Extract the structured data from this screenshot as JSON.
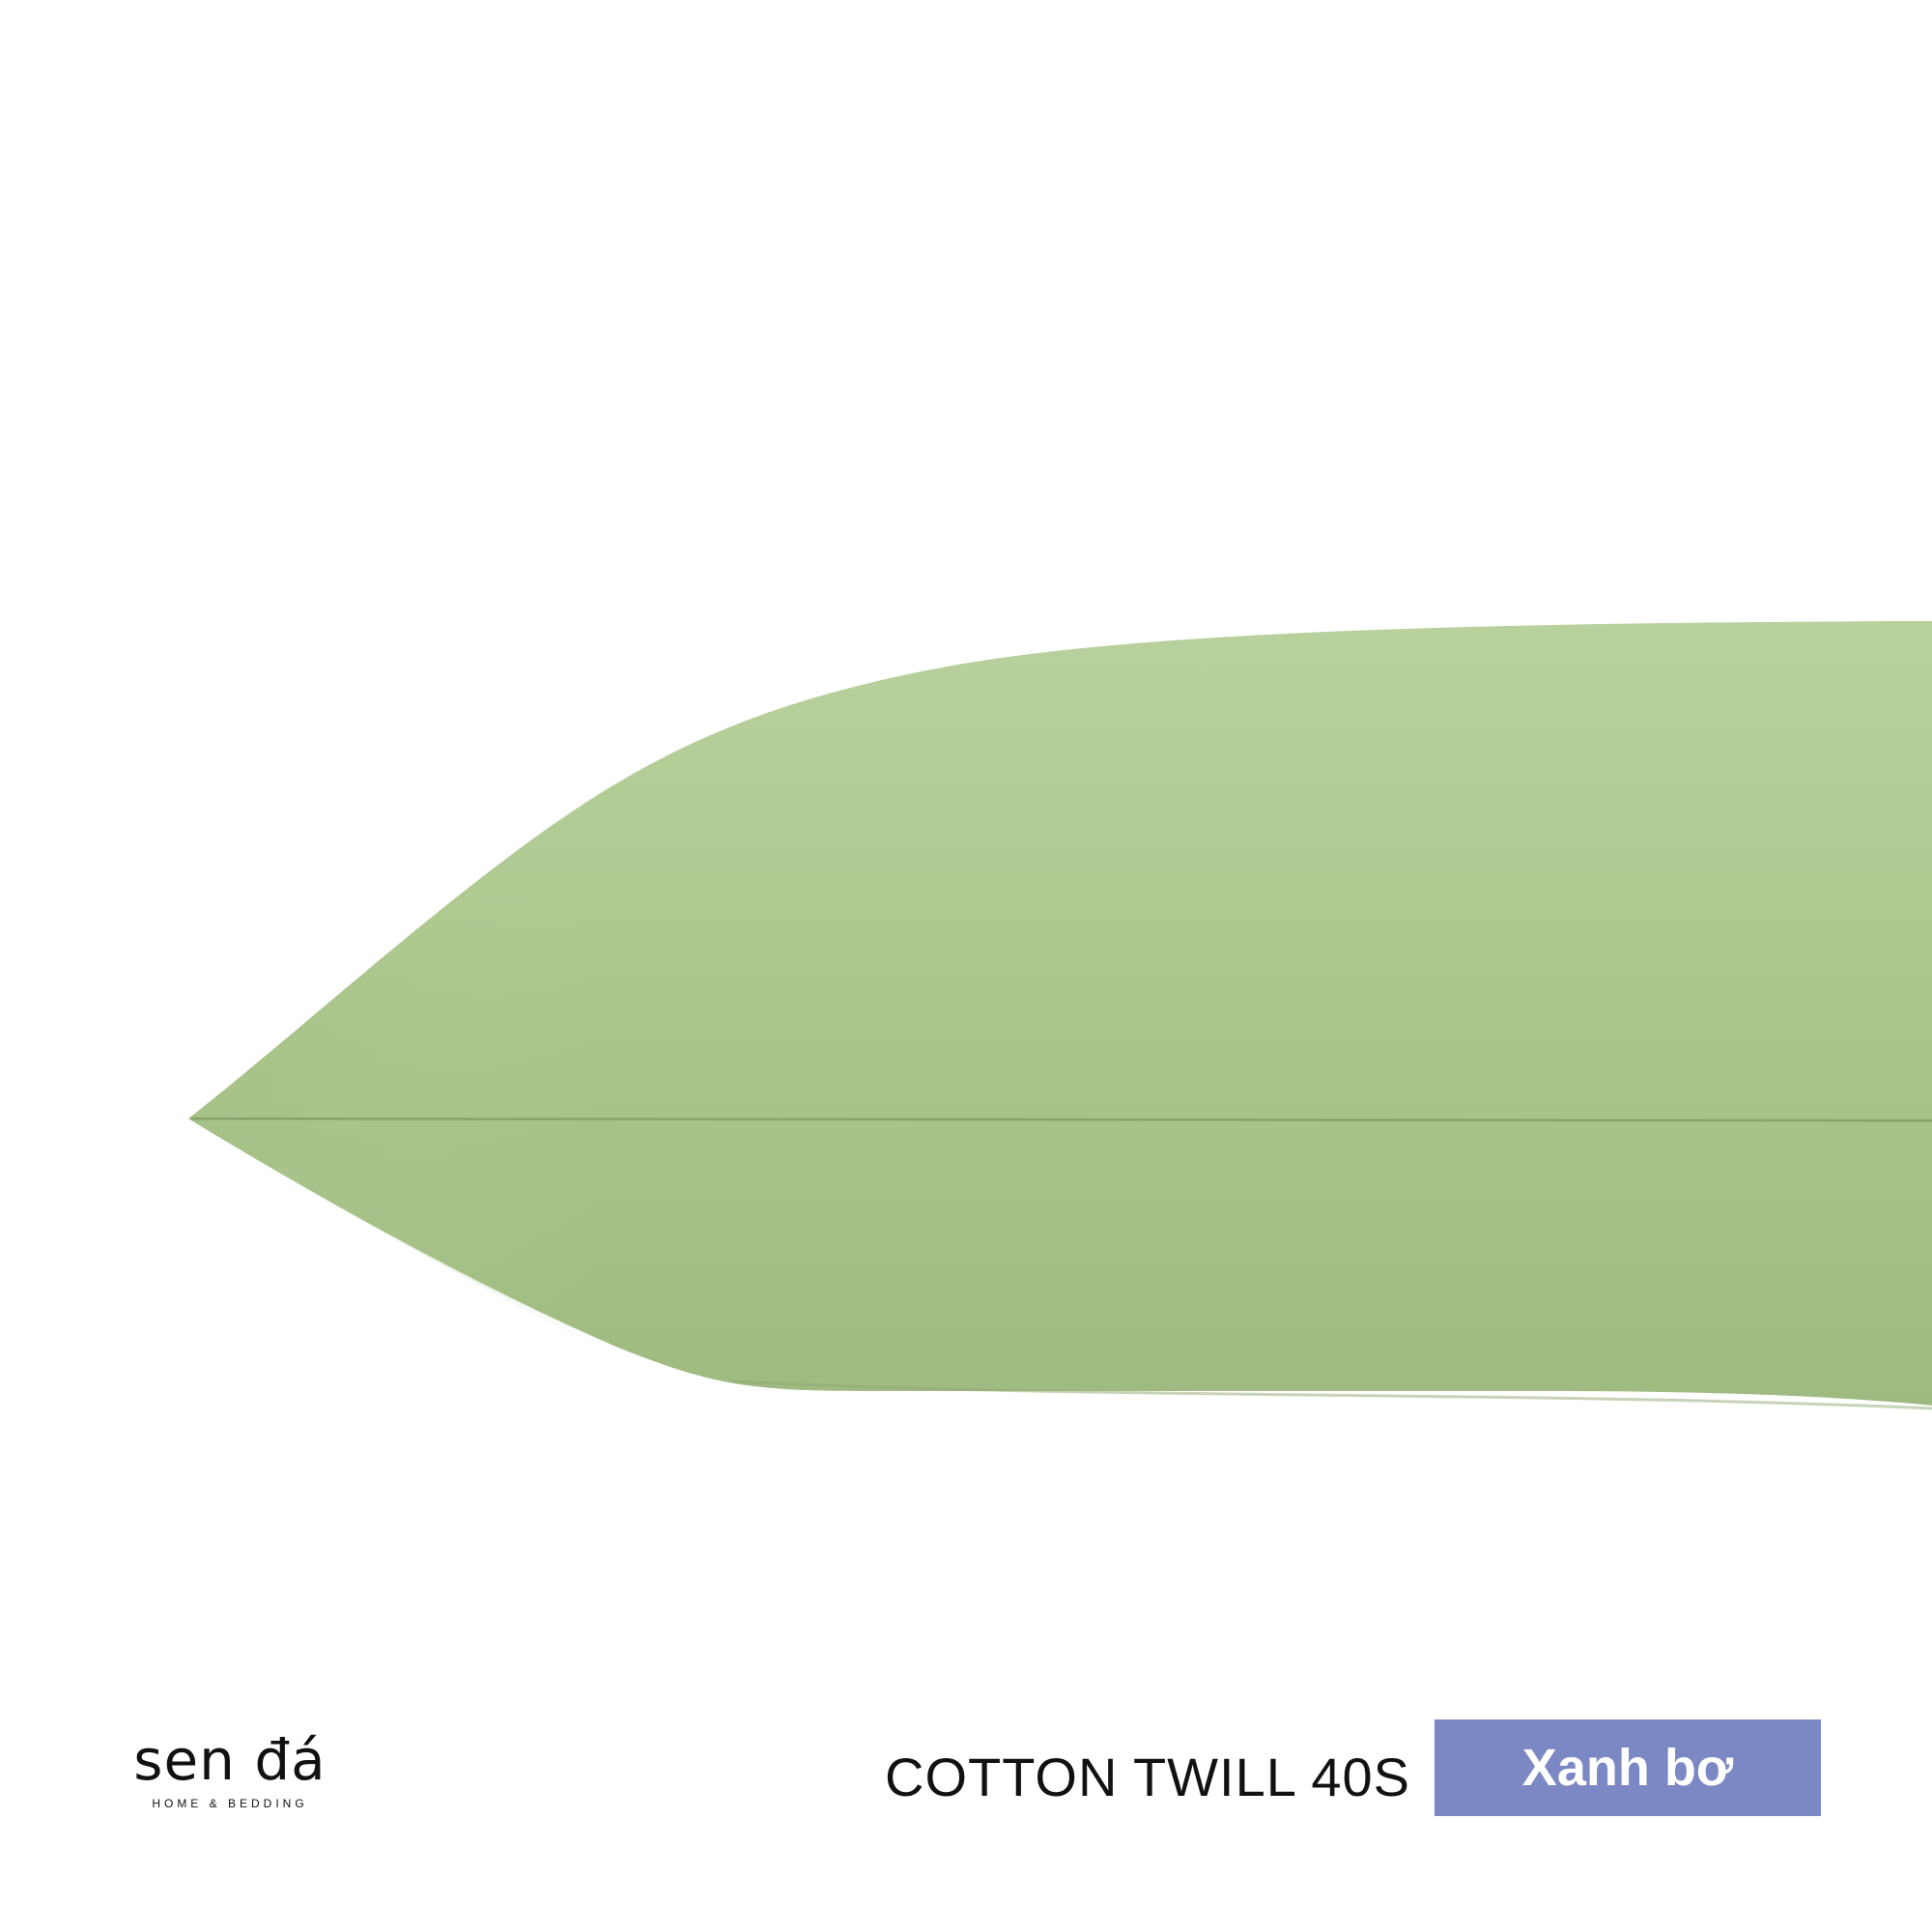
{
  "colors": {
    "background": "#ffffff",
    "pillow_light": "#b8d09b",
    "pillow_mid": "#a9c48a",
    "pillow_shadow": "#98b37a",
    "seam": "#7e9963",
    "badge": "#7c88c3",
    "text": "#111111"
  },
  "brand": {
    "name": "sen đá",
    "tagline": "HOME & BEDDING"
  },
  "product": {
    "line": "COTTON TWILL 40S",
    "color_name": "Xanh bơ"
  },
  "icons": [
    "pillow-image",
    "brand-logo"
  ]
}
